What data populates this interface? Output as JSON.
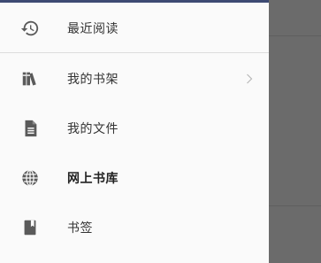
{
  "drawer": {
    "items": [
      {
        "label": "最近阅读",
        "icon": "history-icon"
      },
      {
        "label": "我的书架",
        "icon": "bookshelf-icon",
        "chevron": true
      },
      {
        "label": "我的文件",
        "icon": "document-icon"
      },
      {
        "label": "网上书库",
        "icon": "globe-icon",
        "bold": true
      },
      {
        "label": "书签",
        "icon": "bookmark-icon"
      }
    ]
  },
  "colors": {
    "icon": "#5a5a5a",
    "scrim": "#6b6b6b",
    "accent_top": "#3d4a73"
  }
}
